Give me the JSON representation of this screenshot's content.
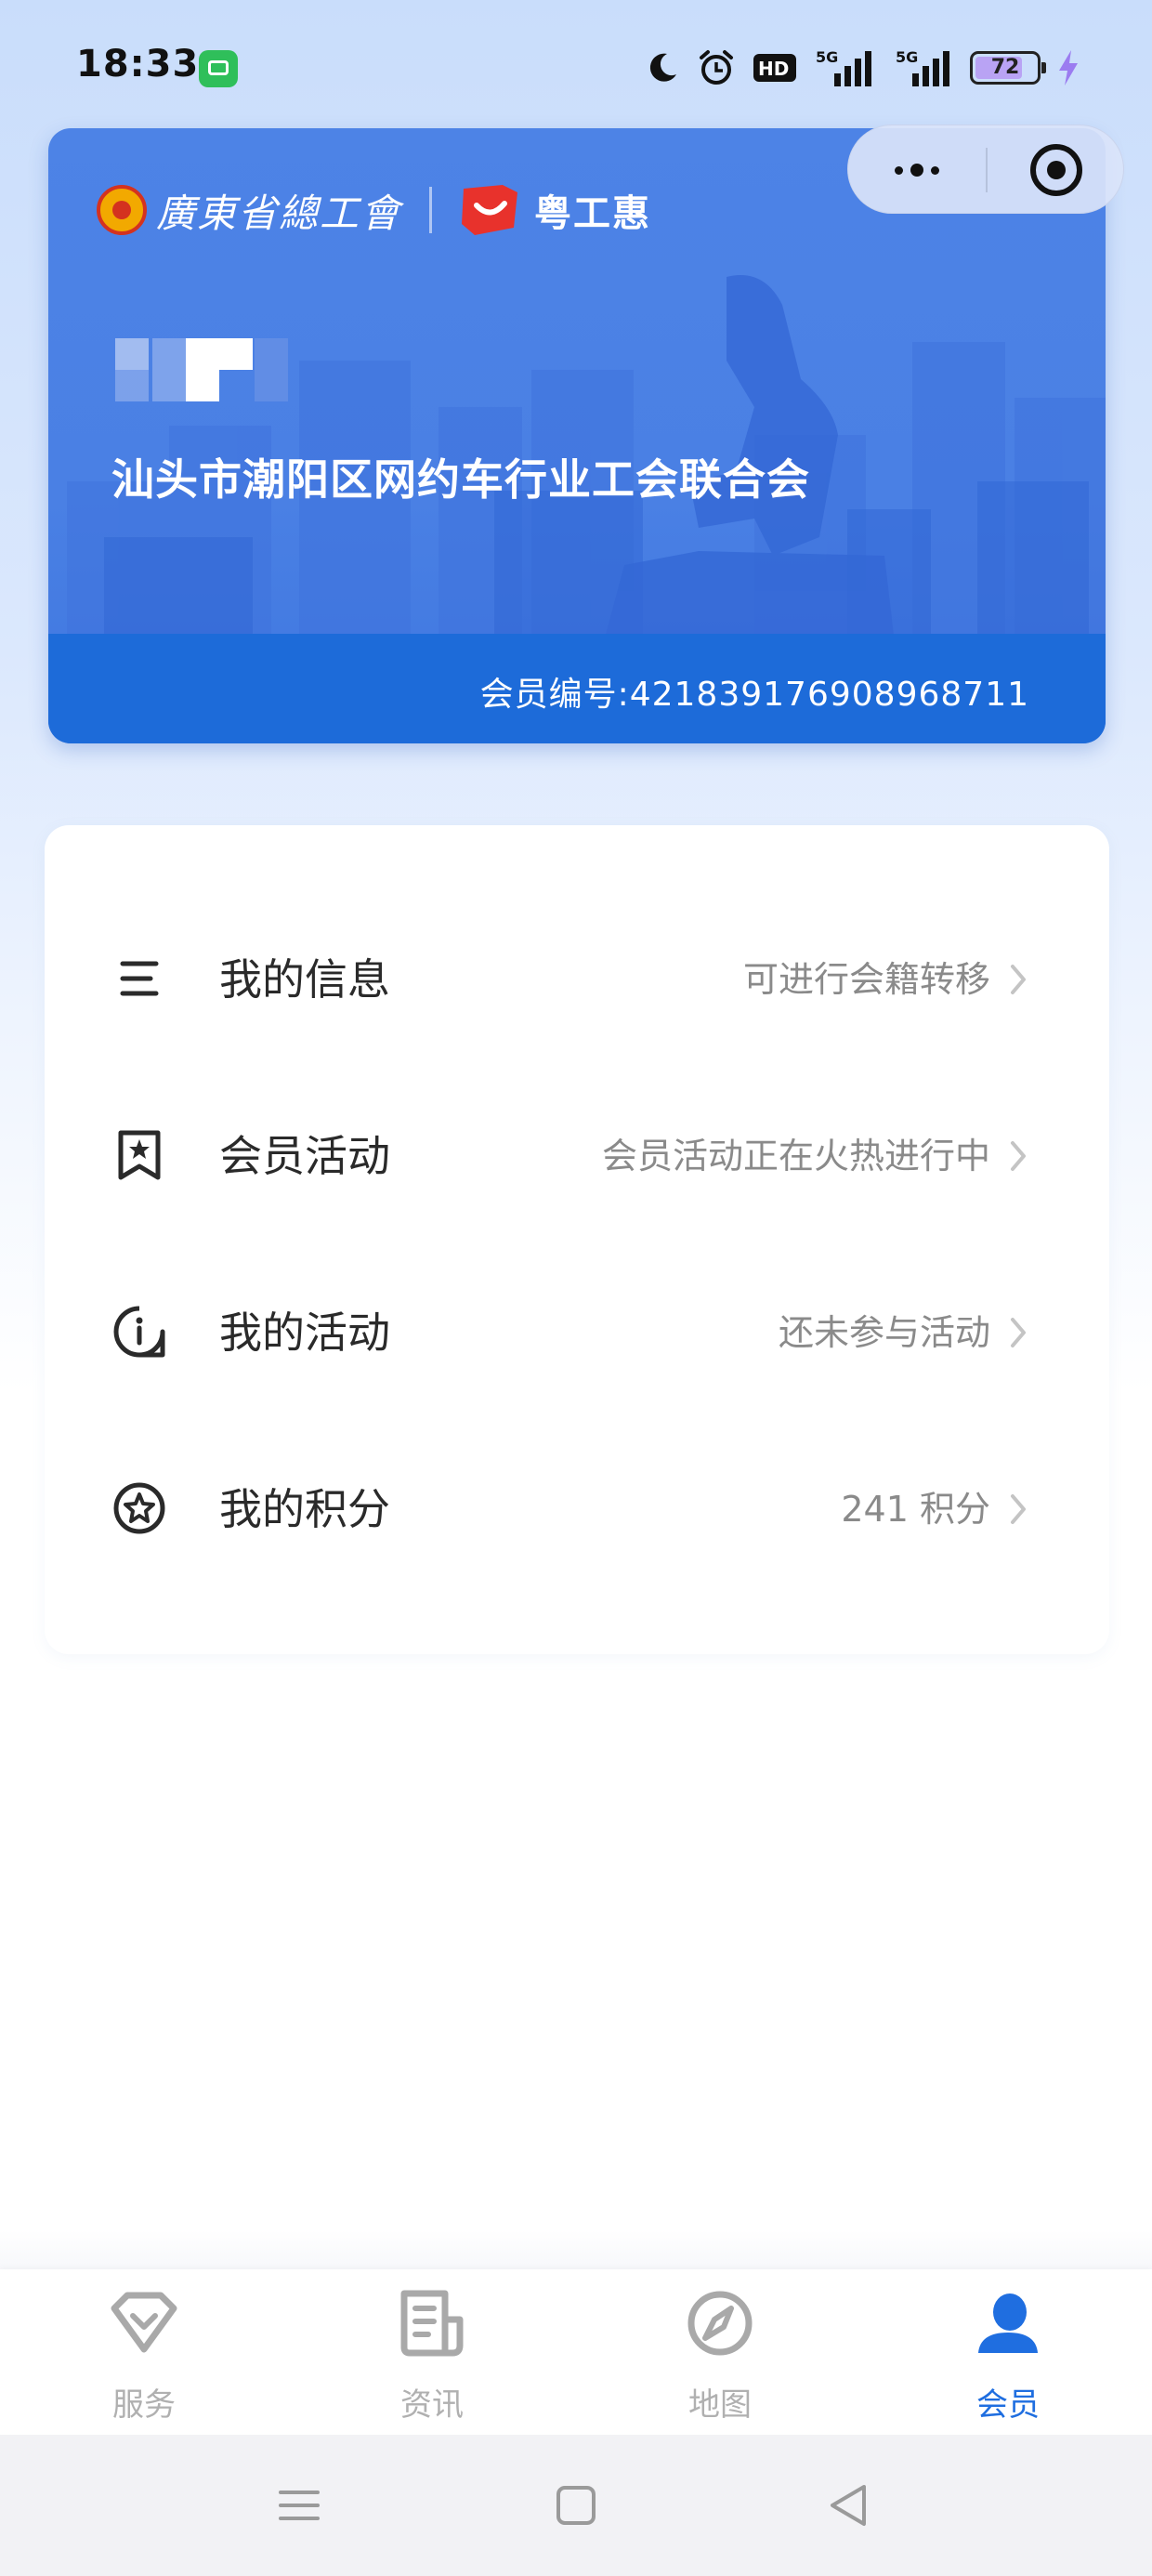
{
  "status_bar": {
    "time": "18:33",
    "icons": [
      "message-app-icon",
      "moon-icon",
      "alarm-icon",
      "hd-icon",
      "5g-signal-icon",
      "5g-signal-icon"
    ],
    "hd_label": "HD",
    "net_label": "5G",
    "battery_level": "72",
    "charging": true
  },
  "capsule": {
    "more_icon": "more-dots-icon",
    "close_icon": "target-close-icon"
  },
  "member_card": {
    "logo_union_text": "廣東省總工會",
    "logo_app_text": "粤工惠",
    "union_name": "汕头市潮阳区网约车行业工会联合会",
    "member_no_label": "会员编号:",
    "member_no": "421839176908968711",
    "accent_color": "#4a80e4",
    "band_color": "#1d6bd9"
  },
  "menu": {
    "items": [
      {
        "label": "我的信息",
        "hint": "可进行会籍转移",
        "icon": "list-icon"
      },
      {
        "label": "会员活动",
        "hint": "会员活动正在火热进行中",
        "icon": "bookmark-star-icon"
      },
      {
        "label": "我的活动",
        "hint": "还未参与活动",
        "icon": "info-bubble-icon"
      },
      {
        "label": "我的积分",
        "hint": "241 积分",
        "icon": "star-badge-icon"
      }
    ]
  },
  "tabbar": {
    "active_color": "#1f6ee0",
    "items": [
      {
        "label": "服务",
        "icon": "service-icon",
        "active": false
      },
      {
        "label": "资讯",
        "icon": "news-icon",
        "active": false
      },
      {
        "label": "地图",
        "icon": "compass-icon",
        "active": false
      },
      {
        "label": "会员",
        "icon": "member-icon",
        "active": true
      }
    ]
  },
  "system_nav": {
    "icons": [
      "menu-icon",
      "home-square-icon",
      "back-triangle-icon"
    ]
  }
}
